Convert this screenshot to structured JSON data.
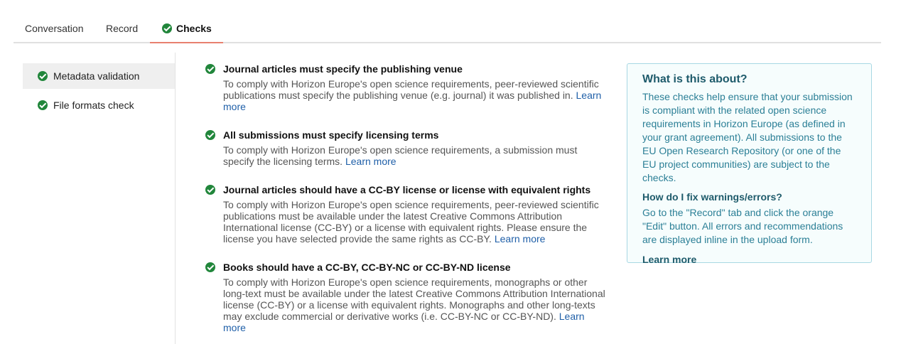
{
  "tabs": [
    {
      "label": "Conversation"
    },
    {
      "label": "Record"
    },
    {
      "label": "Checks",
      "icon": "check-circle-icon",
      "active": true
    }
  ],
  "sidebar": {
    "items": [
      {
        "label": "Metadata validation",
        "icon": "check-circle-icon",
        "active": true
      },
      {
        "label": "File formats check",
        "icon": "check-circle-icon",
        "active": false
      }
    ]
  },
  "checks": [
    {
      "title": "Journal articles must specify the publishing venue",
      "text": "To comply with Horizon Europe's open science requirements, peer-reviewed scientific publications must specify the publishing venue (e.g. journal) it was published in.",
      "link": "Learn more"
    },
    {
      "title": "All submissions must specify licensing terms",
      "text": "To comply with Horizon Europe's open science requirements, a submission must specify the licensing terms.",
      "link": "Learn more"
    },
    {
      "title": "Journal articles should have a CC-BY license or license with equivalent rights",
      "text": "To comply with Horizon Europe's open science requirements, peer-reviewed scientific publications must be available under the latest Creative Commons Attribution International license (CC-BY) or a license with equivalent rights. Please ensure the license you have selected provide the same rights as CC-BY.",
      "link": "Learn more"
    },
    {
      "title": "Books should have a CC-BY, CC-BY-NC or CC-BY-ND license",
      "text": "To comply with Horizon Europe's open science requirements, monographs or other long-text must be available under the latest Creative Commons Attribution International license (CC-BY) or a license with equivalent rights. Monographs and other long-texts may exclude commercial or derivative works (i.e. CC-BY-NC or CC-BY-ND).",
      "link": "Learn more"
    }
  ],
  "info": {
    "title": "What is this about?",
    "text": "These checks help ensure that your submission is compliant with the related open science requirements in Horizon Europe (as defined in your grant agreement). All submissions to the EU Open Research Repository (or one of the EU project communities) are subject to the checks.",
    "subtitle": "How do I fix warnings/errors?",
    "text2": "Go to the \"Record\" tab and click the orange \"Edit\" button. All errors and recommendations are displayed inline in the upload form.",
    "link": "Learn more"
  },
  "colors": {
    "success": "#21863b",
    "active_tab_underline": "#e8806f",
    "link": "#1f5fa8",
    "info_accent": "#2b7f96"
  }
}
